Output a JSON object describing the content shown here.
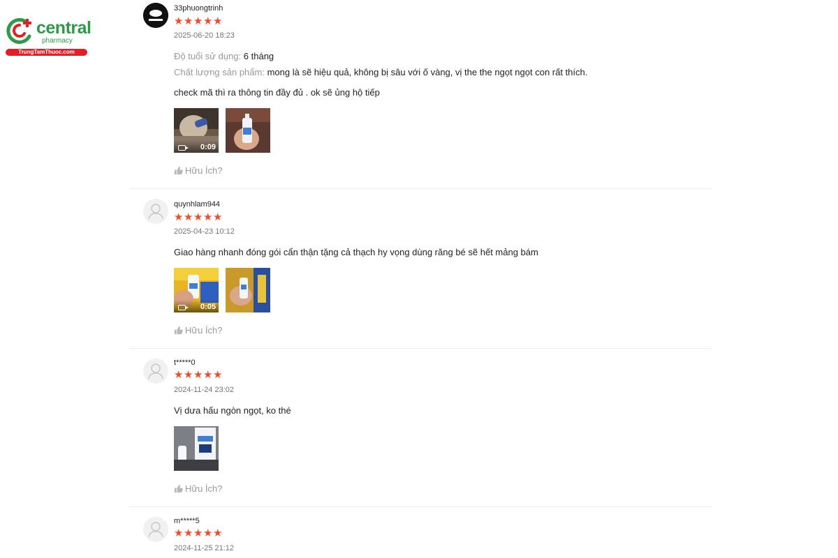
{
  "brand": {
    "name": "central",
    "sub": "pharmacy",
    "bar": "TrungTamThuoc.com",
    "colors": {
      "green": "#2e9a47",
      "red": "#e41e26",
      "star": "#ee4d2d"
    }
  },
  "helpful_label": "Hữu Ích?",
  "reviews": [
    {
      "username": "33phuongtrinh",
      "rating": 5,
      "datetime": "2025-06-20 18:23",
      "attributes": [
        {
          "key": "Độ tuổi sử dụng:",
          "value": "6 tháng"
        },
        {
          "key": "Chất lượng sản phẩm:",
          "value": "mong là sẽ hiệu quả, không bị sâu với ố vàng, vị the the ngọt ngọt con rất thích."
        }
      ],
      "comment": "check mã thì ra thông tin đầy đủ . ok sẽ ủng hộ tiếp",
      "media": [
        {
          "type": "video",
          "duration": "0:09"
        },
        {
          "type": "image"
        }
      ]
    },
    {
      "username": "quynhlam944",
      "rating": 5,
      "datetime": "2025-04-23 10:12",
      "attributes": [],
      "comment": "Giao hàng nhanh đóng gói cẩn thận tặng cả thạch hy vọng dùng răng bé sẽ hết mảng bám",
      "media": [
        {
          "type": "video",
          "duration": "0:05"
        },
        {
          "type": "image"
        }
      ]
    },
    {
      "username": "t*****0",
      "rating": 5,
      "datetime": "2024-11-24 23:02",
      "attributes": [],
      "comment": "Vị dưa hấu ngòn ngọt, ko thé",
      "media": [
        {
          "type": "image"
        }
      ]
    },
    {
      "username": "m*****5",
      "rating": 5,
      "datetime": "2024-11-25 21:12",
      "attributes": [],
      "comment": "",
      "media": []
    }
  ]
}
